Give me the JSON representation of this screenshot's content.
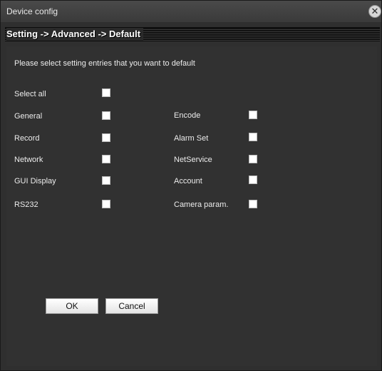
{
  "window": {
    "title": "Device config"
  },
  "breadcrumb": "Setting -> Advanced -> Default",
  "intro_text": "Please select setting entries that you want to default",
  "select_all": {
    "label": "Select all",
    "checked": false
  },
  "left_column": [
    {
      "label": "General",
      "checked": false
    },
    {
      "label": "Record",
      "checked": false
    },
    {
      "label": "Network",
      "checked": false
    },
    {
      "label": "GUI Display",
      "checked": false
    },
    {
      "label": "RS232",
      "checked": false
    }
  ],
  "right_column": [
    {
      "label": "Encode",
      "checked": false
    },
    {
      "label": "Alarm Set",
      "checked": false
    },
    {
      "label": "NetService",
      "checked": false
    },
    {
      "label": "Account",
      "checked": false
    },
    {
      "label": "Camera param.",
      "checked": false
    }
  ],
  "buttons": {
    "ok": "OK",
    "cancel": "Cancel"
  },
  "colors": {
    "window_bg": "#2f2f2f",
    "text": "#ececec",
    "breadcrumb_text": "#ffffff"
  }
}
